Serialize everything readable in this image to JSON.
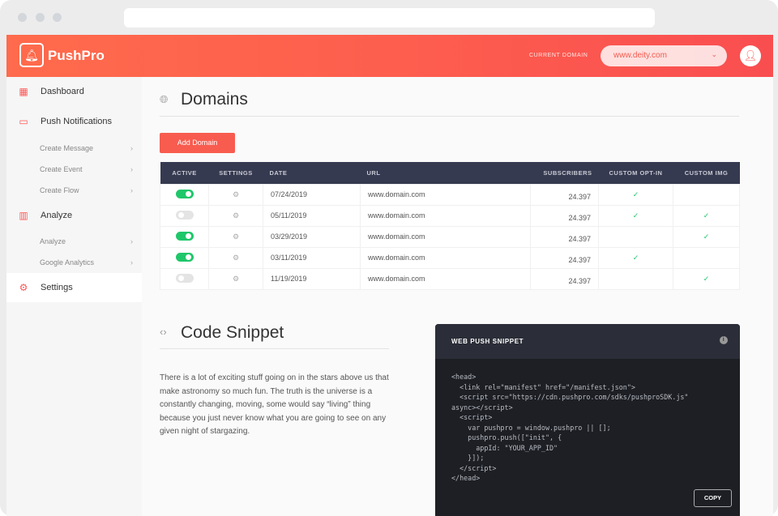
{
  "header": {
    "brand": "PushPro",
    "current_domain_label": "CURRENT DOMAIN",
    "current_domain": "www.deity.com"
  },
  "sidebar": {
    "dashboard": "Dashboard",
    "push": "Push Notifications",
    "create_message": "Create Message",
    "create_event": "Create Event",
    "create_flow": "Create Flow",
    "analyze": "Analyze",
    "analyze_sub": "Analyze",
    "google": "Google Analytics",
    "settings": "Settings"
  },
  "domains": {
    "title": "Domains",
    "add_button": "Add Domain",
    "columns": [
      "ACTIVE",
      "SETTINGS",
      "DATE",
      "URL",
      "SUBSCRIBERS",
      "CUSTOM OPT-IN",
      "CUSTOM IMG"
    ],
    "rows": [
      {
        "active": true,
        "date": "07/24/2019",
        "url": "www.domain.com",
        "subscribers": "24.397",
        "optin": "✓",
        "img": ""
      },
      {
        "active": false,
        "date": "05/11/2019",
        "url": "www.domain.com",
        "subscribers": "24.397",
        "optin": "✓",
        "img": "✓"
      },
      {
        "active": true,
        "date": "03/29/2019",
        "url": "www.domain.com",
        "subscribers": "24.397",
        "optin": "",
        "img": "✓"
      },
      {
        "active": true,
        "date": "03/11/2019",
        "url": "www.domain.com",
        "subscribers": "24.397",
        "optin": "✓",
        "img": ""
      },
      {
        "active": false,
        "date": "11/19/2019",
        "url": "www.domain.com",
        "subscribers": "24.397",
        "optin": "",
        "img": "✓"
      }
    ]
  },
  "snippet": {
    "title": "Code Snippet",
    "description": "There is a lot of exciting stuff going on in the stars above us that make astronomy so much fun. The truth is the universe is a constantly changing, moving, some would say “living” thing because you just never know what you are going to see on any given night of stargazing.",
    "card_title": "WEB PUSH SNIPPET",
    "copy_label": "COPY",
    "code": "<head>\n  <link rel=\"manifest\" href=\"/manifest.json\">\n  <script src=\"https://cdn.pushpro.com/sdks/pushproSDK.js\"\nasync></script>\n  <script>\n    var pushpro = window.pushpro || [];\n    pushpro.push([\"init\", {\n      appId: \"YOUR_APP_ID\"\n    }]);\n  </script>\n</head>"
  }
}
